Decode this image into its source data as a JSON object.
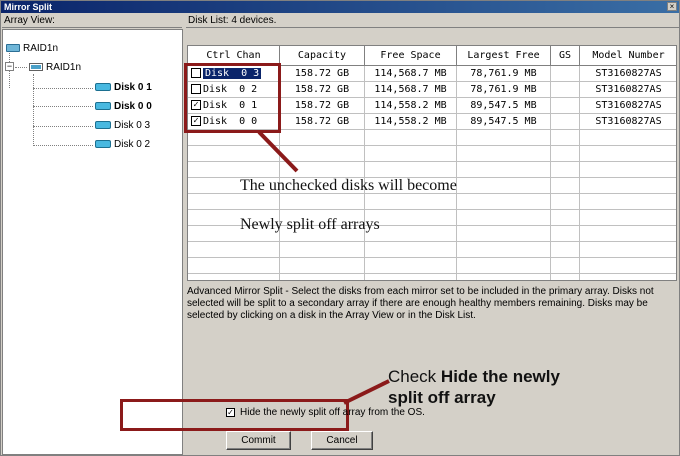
{
  "window": {
    "title": "Mirror Split",
    "close_glyph": "×"
  },
  "left": {
    "header": "Array View:",
    "tree": [
      {
        "label": "RAID1n",
        "icon": "drive-icon",
        "bold": false
      },
      {
        "label": "RAID1n",
        "icon": "array-icon",
        "bold": false
      },
      {
        "label": "Disk  0 1",
        "icon": "disk-icon",
        "bold": true
      },
      {
        "label": "Disk  0 0",
        "icon": "disk-icon",
        "bold": true
      },
      {
        "label": "Disk  0 3",
        "icon": "disk-icon",
        "bold": false
      },
      {
        "label": "Disk  0 2",
        "icon": "disk-icon",
        "bold": false
      }
    ]
  },
  "right": {
    "title": "Disk List: 4 devices.",
    "columns": [
      "Ctrl Chan",
      "Capacity",
      "Free Space",
      "Largest Free",
      "GS",
      "Model Number"
    ],
    "rows": [
      {
        "checked": false,
        "ctrl": "Disk  0 3",
        "capacity": "158.72 GB",
        "free": "114,568.7 MB",
        "largest": "78,761.9 MB",
        "gs": "",
        "model": "ST3160827AS",
        "selected": true
      },
      {
        "checked": false,
        "ctrl": "Disk  0 2",
        "capacity": "158.72 GB",
        "free": "114,568.7 MB",
        "largest": "78,761.9 MB",
        "gs": "",
        "model": "ST3160827AS",
        "selected": false
      },
      {
        "checked": true,
        "ctrl": "Disk  0 1",
        "capacity": "158.72 GB",
        "free": "114,558.2 MB",
        "largest": "89,547.5 MB",
        "gs": "",
        "model": "ST3160827AS",
        "selected": false
      },
      {
        "checked": true,
        "ctrl": "Disk  0 0",
        "capacity": "158.72 GB",
        "free": "114,558.2 MB",
        "largest": "89,547.5 MB",
        "gs": "",
        "model": "ST3160827AS",
        "selected": false
      }
    ],
    "check_glyph": "✓"
  },
  "annotations": {
    "line1": "The unchecked disks will become",
    "line2": "Newly split off arrays",
    "check_prefix": "Check ",
    "check_bold_1": "Hide the newly",
    "check_bold_2": "split off array"
  },
  "info_text": "Advanced Mirror Split - Select the disks from each mirror set to be included in the primary array. Disks not selected will be split to a secondary array if there are enough healthy members remaining. Disks may be selected by clicking on a disk in the Array View or in the Disk List.",
  "options": {
    "hide_label": "Hide the newly  split off array from the OS.",
    "hide_checked": true
  },
  "buttons": {
    "commit": "Commit",
    "cancel": "Cancel"
  },
  "colors": {
    "title_bar": "#0a246a",
    "highlight_box": "#8b1a1a",
    "selection": "#0a246a"
  }
}
